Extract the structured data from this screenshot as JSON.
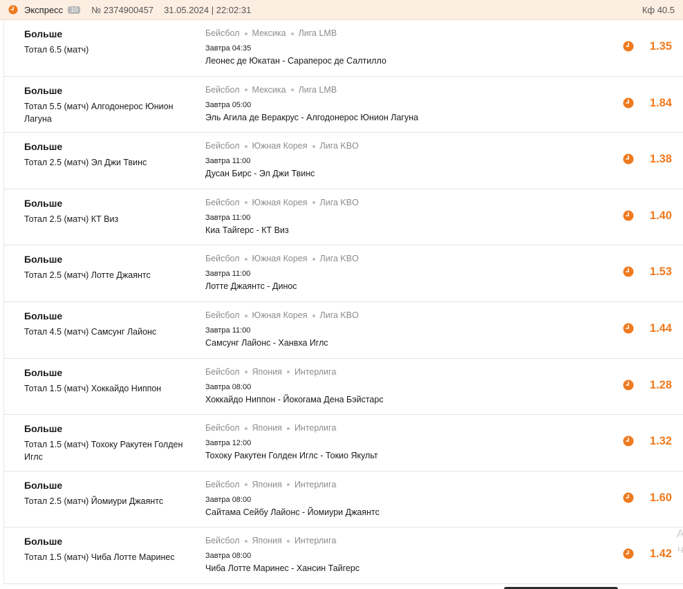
{
  "header": {
    "title": "Экспресс",
    "badge": "10",
    "number": "№ 2374900457",
    "datetime": "31.05.2024 | 22:02:31",
    "total_coef": "Кф 40.5",
    "icon": "clock-icon",
    "accent_color": "#f07a1e"
  },
  "bets": [
    {
      "outcome": "Больше",
      "market": "Тотал 6.5 (матч)",
      "sport": "Бейсбол",
      "country": "Мексика",
      "league": "Лига LMB",
      "time": "Завтра 04:35",
      "match": "Леонес де Юкатан - Сараперос де Салтилло",
      "odds": "1.35"
    },
    {
      "outcome": "Больше",
      "market": "Тотал 5.5 (матч) Алгодонерос Юнион Лагуна",
      "sport": "Бейсбол",
      "country": "Мексика",
      "league": "Лига LMB",
      "time": "Завтра 05:00",
      "match": "Эль Агила де Веракрус - Алгодонерос Юнион Лагуна",
      "odds": "1.84"
    },
    {
      "outcome": "Больше",
      "market": "Тотал 2.5 (матч) Эл Джи Твинс",
      "sport": "Бейсбол",
      "country": "Южная Корея",
      "league": "Лига KBO",
      "time": "Завтра 11:00",
      "match": "Дусан Бирс - Эл Джи Твинс",
      "odds": "1.38"
    },
    {
      "outcome": "Больше",
      "market": "Тотал 2.5 (матч) КТ Виз",
      "sport": "Бейсбол",
      "country": "Южная Корея",
      "league": "Лига KBO",
      "time": "Завтра 11:00",
      "match": "Киа Тайгерс - КТ Виз",
      "odds": "1.40"
    },
    {
      "outcome": "Больше",
      "market": "Тотал 2.5 (матч) Лотте Джаянтс",
      "sport": "Бейсбол",
      "country": "Южная Корея",
      "league": "Лига KBO",
      "time": "Завтра 11:00",
      "match": "Лотте Джаянтс - Динос",
      "odds": "1.53"
    },
    {
      "outcome": "Больше",
      "market": "Тотал 4.5 (матч) Самсунг Лайонс",
      "sport": "Бейсбол",
      "country": "Южная Корея",
      "league": "Лига KBO",
      "time": "Завтра 11:00",
      "match": "Самсунг Лайонс - Ханвха Иглс",
      "odds": "1.44"
    },
    {
      "outcome": "Больше",
      "market": "Тотал 1.5 (матч) Хоккайдо Ниппон",
      "sport": "Бейсбол",
      "country": "Япония",
      "league": "Интерлига",
      "time": "Завтра 08:00",
      "match": "Хоккайдо Ниппон - Йокогама Дена Бэйстарс",
      "odds": "1.28"
    },
    {
      "outcome": "Больше",
      "market": "Тотал 1.5 (матч) Тохоку Ракутен Голден Иглс",
      "sport": "Бейсбол",
      "country": "Япония",
      "league": "Интерлига",
      "time": "Завтра 12:00",
      "match": "Тохоку Ракутен Голден Иглс - Токио Якульт",
      "odds": "1.32"
    },
    {
      "outcome": "Больше",
      "market": "Тотал 2.5 (матч) Йомиури Джаянтс",
      "sport": "Бейсбол",
      "country": "Япония",
      "league": "Интерлига",
      "time": "Завтра 08:00",
      "match": "Сайтама Сейбу Лайонс - Йомиури Джаянтс",
      "odds": "1.60"
    },
    {
      "outcome": "Больше",
      "market": "Тотал 1.5 (матч) Чиба Лотте Маринес",
      "sport": "Бейсбол",
      "country": "Япония",
      "league": "Интерлига",
      "time": "Завтра 08:00",
      "match": "Чиба Лотте Маринес - Хансин Тайгерс",
      "odds": "1.42"
    }
  ],
  "side_fragment": {
    "line1": "А",
    "line2": "Ч"
  }
}
